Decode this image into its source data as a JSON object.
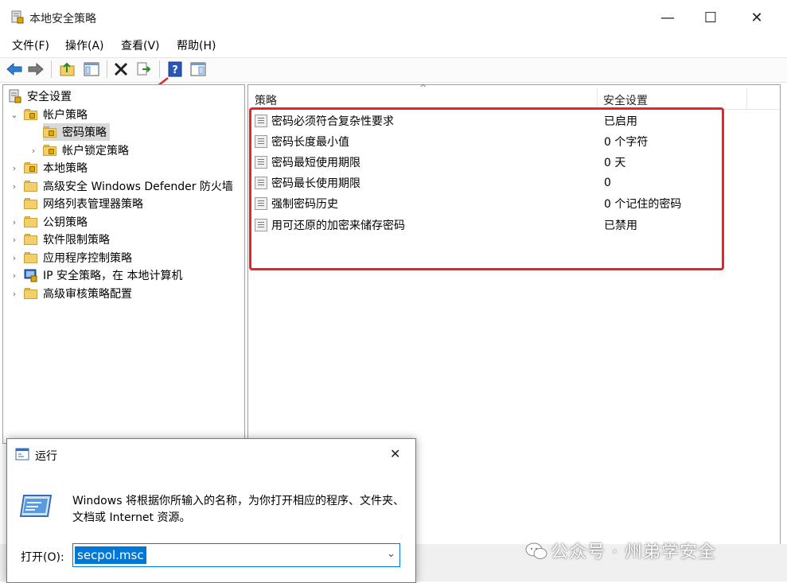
{
  "window": {
    "title": "本地安全策略",
    "minimize": "—",
    "maximize": "☐",
    "close": "✕"
  },
  "menu": [
    "文件(F)",
    "操作(A)",
    "查看(V)",
    "帮助(H)"
  ],
  "toolbar": [
    "back-icon",
    "forward-icon",
    "up-folder-icon",
    "show-hide-tree-icon",
    "delete-icon",
    "export-icon",
    "help-icon",
    "console-icon"
  ],
  "tree": {
    "root": "安全设置",
    "items": [
      {
        "label": "帐户策略",
        "expander": "⌄"
      },
      {
        "label": "密码策略",
        "expander": ""
      },
      {
        "label": "帐户锁定策略",
        "expander": "›"
      },
      {
        "label": "本地策略",
        "expander": "›"
      },
      {
        "label": "高级安全 Windows Defender 防火墙",
        "expander": "›"
      },
      {
        "label": "网络列表管理器策略",
        "expander": ""
      },
      {
        "label": "公钥策略",
        "expander": "›"
      },
      {
        "label": "软件限制策略",
        "expander": "›"
      },
      {
        "label": "应用程序控制策略",
        "expander": "›"
      },
      {
        "label": "IP 安全策略，在 本地计算机",
        "expander": "›"
      },
      {
        "label": "高级审核策略配置",
        "expander": "›"
      }
    ]
  },
  "list": {
    "columns": [
      "策略",
      "安全设置"
    ],
    "sort_indicator": "^",
    "rows": [
      {
        "policy": "密码必须符合复杂性要求",
        "setting": "已启用"
      },
      {
        "policy": "密码长度最小值",
        "setting": "0 个字符"
      },
      {
        "policy": "密码最短使用期限",
        "setting": "0 天"
      },
      {
        "policy": "密码最长使用期限",
        "setting": "0"
      },
      {
        "policy": "强制密码历史",
        "setting": "0 个记住的密码"
      },
      {
        "policy": "用可还原的加密来储存密码",
        "setting": "已禁用"
      }
    ]
  },
  "run_dialog": {
    "title": "运行",
    "close": "✕",
    "message": "Windows 将根据你所输入的名称，为你打开相应的程序、文件夹、文档或 Internet 资源。",
    "open_label": "打开(O):",
    "input_value": "secpol.msc",
    "dropdown": "⌄"
  },
  "watermark": "公众号 · 州弟学安全",
  "colors": {
    "highlight": "#e5252a",
    "selection": "#0078d7"
  }
}
